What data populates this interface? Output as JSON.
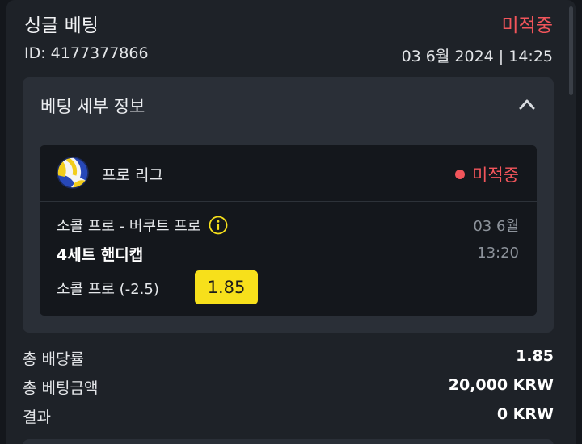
{
  "header": {
    "title": "싱글 베팅",
    "status": "미적중",
    "id_text": "ID: 4177377866",
    "datetime": "03 6월 2024 | 14:25"
  },
  "details": {
    "title": "베팅 세부 정보",
    "toggle_icon": "chevron-up-icon",
    "league": {
      "icon": "volleyball-icon",
      "name": "프로 리그",
      "status": "미적중"
    },
    "match": {
      "teams": "소콜 프로 - 버쿠트 프로",
      "info_icon": "info-icon",
      "date": "03 6월",
      "time": "13:20",
      "market": "4세트 핸디캡",
      "selection": "소콜 프로 (-2.5)",
      "odds": "1.85"
    }
  },
  "summary": {
    "total_odds_label": "총 배당률",
    "total_odds_value": "1.85",
    "total_stake_label": "총 베팅금액",
    "total_stake_value": "20,000 KRW",
    "result_label": "결과",
    "result_value": "0 KRW"
  },
  "colors": {
    "background": "#14171c",
    "card": "#1e2228",
    "panel": "#2a2f37",
    "lost": "#f2555b",
    "odds_badge": "#f7e01b",
    "muted_text": "#8d939b"
  }
}
